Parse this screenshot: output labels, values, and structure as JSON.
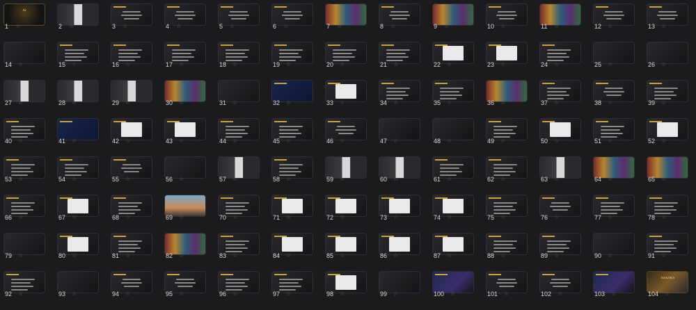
{
  "colors": {
    "background": "#1b1b1d",
    "accent": "#c9a43a",
    "star": "#6b6b6b"
  },
  "slides": [
    {
      "n": "1",
      "v": "cover",
      "t": "AI"
    },
    {
      "n": "2",
      "v": "photo"
    },
    {
      "n": "3",
      "v": "text"
    },
    {
      "n": "4",
      "v": "text"
    },
    {
      "n": "5",
      "v": "text"
    },
    {
      "n": "6",
      "v": "text"
    },
    {
      "n": "7",
      "v": "color"
    },
    {
      "n": "8",
      "v": "text"
    },
    {
      "n": "9",
      "v": "color"
    },
    {
      "n": "10",
      "v": "text"
    },
    {
      "n": "11",
      "v": "color"
    },
    {
      "n": "12",
      "v": "text"
    },
    {
      "n": "13",
      "v": "text"
    },
    {
      "n": "14",
      "v": "dark"
    },
    {
      "n": "15",
      "v": "list"
    },
    {
      "n": "16",
      "v": "list"
    },
    {
      "n": "17",
      "v": "list"
    },
    {
      "n": "18",
      "v": "list"
    },
    {
      "n": "19",
      "v": "list"
    },
    {
      "n": "20",
      "v": "list"
    },
    {
      "n": "21",
      "v": "list"
    },
    {
      "n": "22",
      "v": "doc"
    },
    {
      "n": "23",
      "v": "doc"
    },
    {
      "n": "24",
      "v": "list"
    },
    {
      "n": "25",
      "v": "dark"
    },
    {
      "n": "26",
      "v": "dark"
    },
    {
      "n": "27",
      "v": "photo"
    },
    {
      "n": "28",
      "v": "photo"
    },
    {
      "n": "29",
      "v": "photo"
    },
    {
      "n": "30",
      "v": "color"
    },
    {
      "n": "31",
      "v": "dark"
    },
    {
      "n": "32",
      "v": "blue"
    },
    {
      "n": "33",
      "v": "doc"
    },
    {
      "n": "34",
      "v": "list"
    },
    {
      "n": "35",
      "v": "list"
    },
    {
      "n": "36",
      "v": "color"
    },
    {
      "n": "37",
      "v": "list"
    },
    {
      "n": "38",
      "v": "text"
    },
    {
      "n": "39",
      "v": "list"
    },
    {
      "n": "40",
      "v": "list"
    },
    {
      "n": "41",
      "v": "blue"
    },
    {
      "n": "42",
      "v": "doc"
    },
    {
      "n": "43",
      "v": "doc"
    },
    {
      "n": "44",
      "v": "list"
    },
    {
      "n": "45",
      "v": "list"
    },
    {
      "n": "46",
      "v": "text"
    },
    {
      "n": "47",
      "v": "dark"
    },
    {
      "n": "48",
      "v": "dark"
    },
    {
      "n": "49",
      "v": "list"
    },
    {
      "n": "50",
      "v": "doc"
    },
    {
      "n": "51",
      "v": "list"
    },
    {
      "n": "52",
      "v": "doc"
    },
    {
      "n": "53",
      "v": "list"
    },
    {
      "n": "54",
      "v": "list"
    },
    {
      "n": "55",
      "v": "text"
    },
    {
      "n": "56",
      "v": "dark"
    },
    {
      "n": "57",
      "v": "photo"
    },
    {
      "n": "58",
      "v": "list"
    },
    {
      "n": "59",
      "v": "photo"
    },
    {
      "n": "60",
      "v": "photo"
    },
    {
      "n": "61",
      "v": "list"
    },
    {
      "n": "62",
      "v": "list"
    },
    {
      "n": "63",
      "v": "photo"
    },
    {
      "n": "64",
      "v": "color"
    },
    {
      "n": "65",
      "v": "color"
    },
    {
      "n": "66",
      "v": "list"
    },
    {
      "n": "67",
      "v": "doc"
    },
    {
      "n": "68",
      "v": "list"
    },
    {
      "n": "69",
      "v": "sky"
    },
    {
      "n": "70",
      "v": "list"
    },
    {
      "n": "71",
      "v": "doc"
    },
    {
      "n": "72",
      "v": "doc"
    },
    {
      "n": "73",
      "v": "doc"
    },
    {
      "n": "74",
      "v": "doc"
    },
    {
      "n": "75",
      "v": "list"
    },
    {
      "n": "76",
      "v": "text"
    },
    {
      "n": "77",
      "v": "list"
    },
    {
      "n": "78",
      "v": "list"
    },
    {
      "n": "79",
      "v": "dark"
    },
    {
      "n": "80",
      "v": "doc"
    },
    {
      "n": "81",
      "v": "list"
    },
    {
      "n": "82",
      "v": "color"
    },
    {
      "n": "83",
      "v": "list"
    },
    {
      "n": "84",
      "v": "doc"
    },
    {
      "n": "85",
      "v": "doc"
    },
    {
      "n": "86",
      "v": "doc"
    },
    {
      "n": "87",
      "v": "doc"
    },
    {
      "n": "88",
      "v": "list"
    },
    {
      "n": "89",
      "v": "list"
    },
    {
      "n": "90",
      "v": "dark"
    },
    {
      "n": "91",
      "v": "list"
    },
    {
      "n": "92",
      "v": "list"
    },
    {
      "n": "93",
      "v": "dark"
    },
    {
      "n": "94",
      "v": "text"
    },
    {
      "n": "95",
      "v": "text"
    },
    {
      "n": "96",
      "v": "list"
    },
    {
      "n": "97",
      "v": "list"
    },
    {
      "n": "98",
      "v": "doc"
    },
    {
      "n": "99",
      "v": "dark"
    },
    {
      "n": "100",
      "v": "brand"
    },
    {
      "n": "101",
      "v": "text"
    },
    {
      "n": "102",
      "v": "text"
    },
    {
      "n": "103",
      "v": "brand"
    },
    {
      "n": "104",
      "v": "thanks",
      "t": "THANKS"
    }
  ]
}
